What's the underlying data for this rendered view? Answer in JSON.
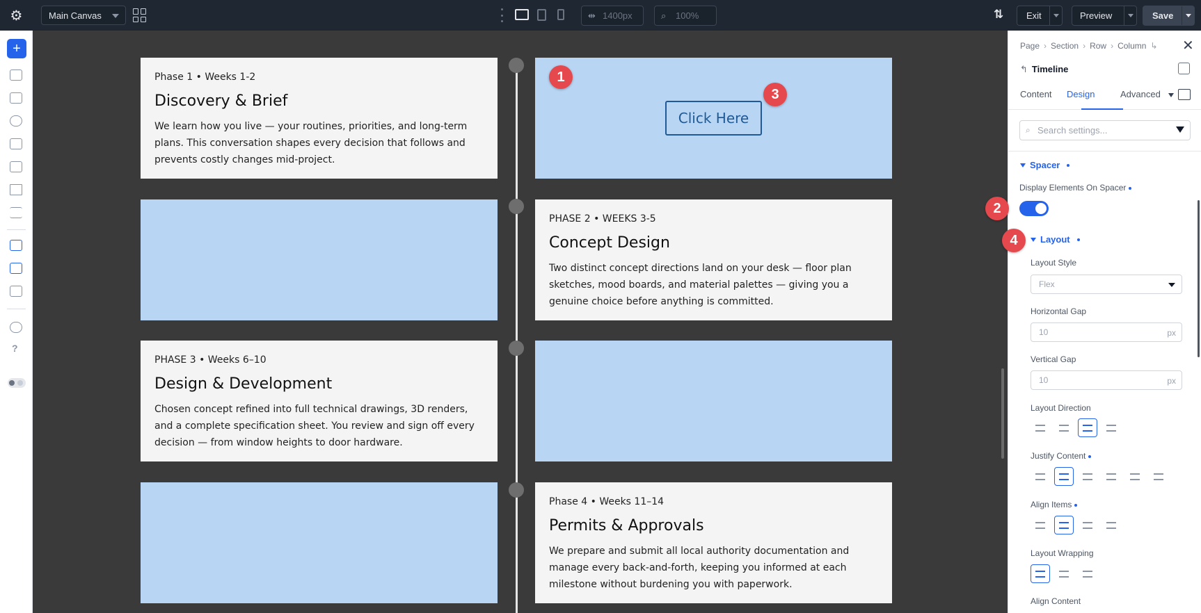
{
  "topbar": {
    "canvas_select": "Main Canvas",
    "width_value": "1400px",
    "zoom_value": "100%",
    "exit_label": "Exit",
    "preview_label": "Preview",
    "save_label": "Save"
  },
  "canvas": {
    "cards": [
      {
        "meta": "Phase 1 • Weeks 1-2",
        "title": "Discovery & Brief",
        "desc": "We learn how you live — your routines, priorities, and long-term plans. This conversation shapes every decision that follows and prevents costly changes mid-project."
      },
      {
        "meta": "PHASE 2 • WEEKS 3-5",
        "title": "Concept Design",
        "desc": "Two distinct concept directions land on your desk — floor plan sketches, mood boards, and material palettes — giving you a genuine choice before anything is committed."
      },
      {
        "meta": "PHASE 3 • Weeks 6–10",
        "title": "Design & Development",
        "desc": "Chosen concept refined into full technical drawings, 3D renders, and a complete specification sheet. You review and sign off every decision — from window heights to door hardware."
      },
      {
        "meta": "Phase 4 • Weeks 11–14",
        "title": "Permits & Approvals",
        "desc": "We prepare and submit all local authority documentation and manage every back-and-forth, keeping you informed at each milestone without burdening you with paperwork."
      }
    ],
    "click_button": "Click Here"
  },
  "badges": [
    "1",
    "2",
    "3",
    "4"
  ],
  "panel": {
    "breadcrumb": [
      "Page",
      "Section",
      "Row",
      "Column"
    ],
    "title": "Timeline",
    "tabs": [
      "Content",
      "Design",
      "Advanced"
    ],
    "search_placeholder": "Search settings...",
    "spacer_section": "Spacer",
    "display_elements_label": "Display Elements On Spacer",
    "display_elements_on": true,
    "layout_section": "Layout",
    "layout_style_label": "Layout Style",
    "layout_style_value": "Flex",
    "horizontal_gap_label": "Horizontal Gap",
    "horizontal_gap_value": "10",
    "vertical_gap_label": "Vertical Gap",
    "vertical_gap_value": "10",
    "unit": "px",
    "layout_direction_label": "Layout Direction",
    "justify_content_label": "Justify Content",
    "align_items_label": "Align Items",
    "layout_wrapping_label": "Layout Wrapping",
    "align_content_label": "Align Content"
  },
  "colors": {
    "accent": "#2563eb",
    "badge": "#e5484d",
    "spacer_block": "#b8d5f3",
    "topbar": "#1f2732"
  }
}
